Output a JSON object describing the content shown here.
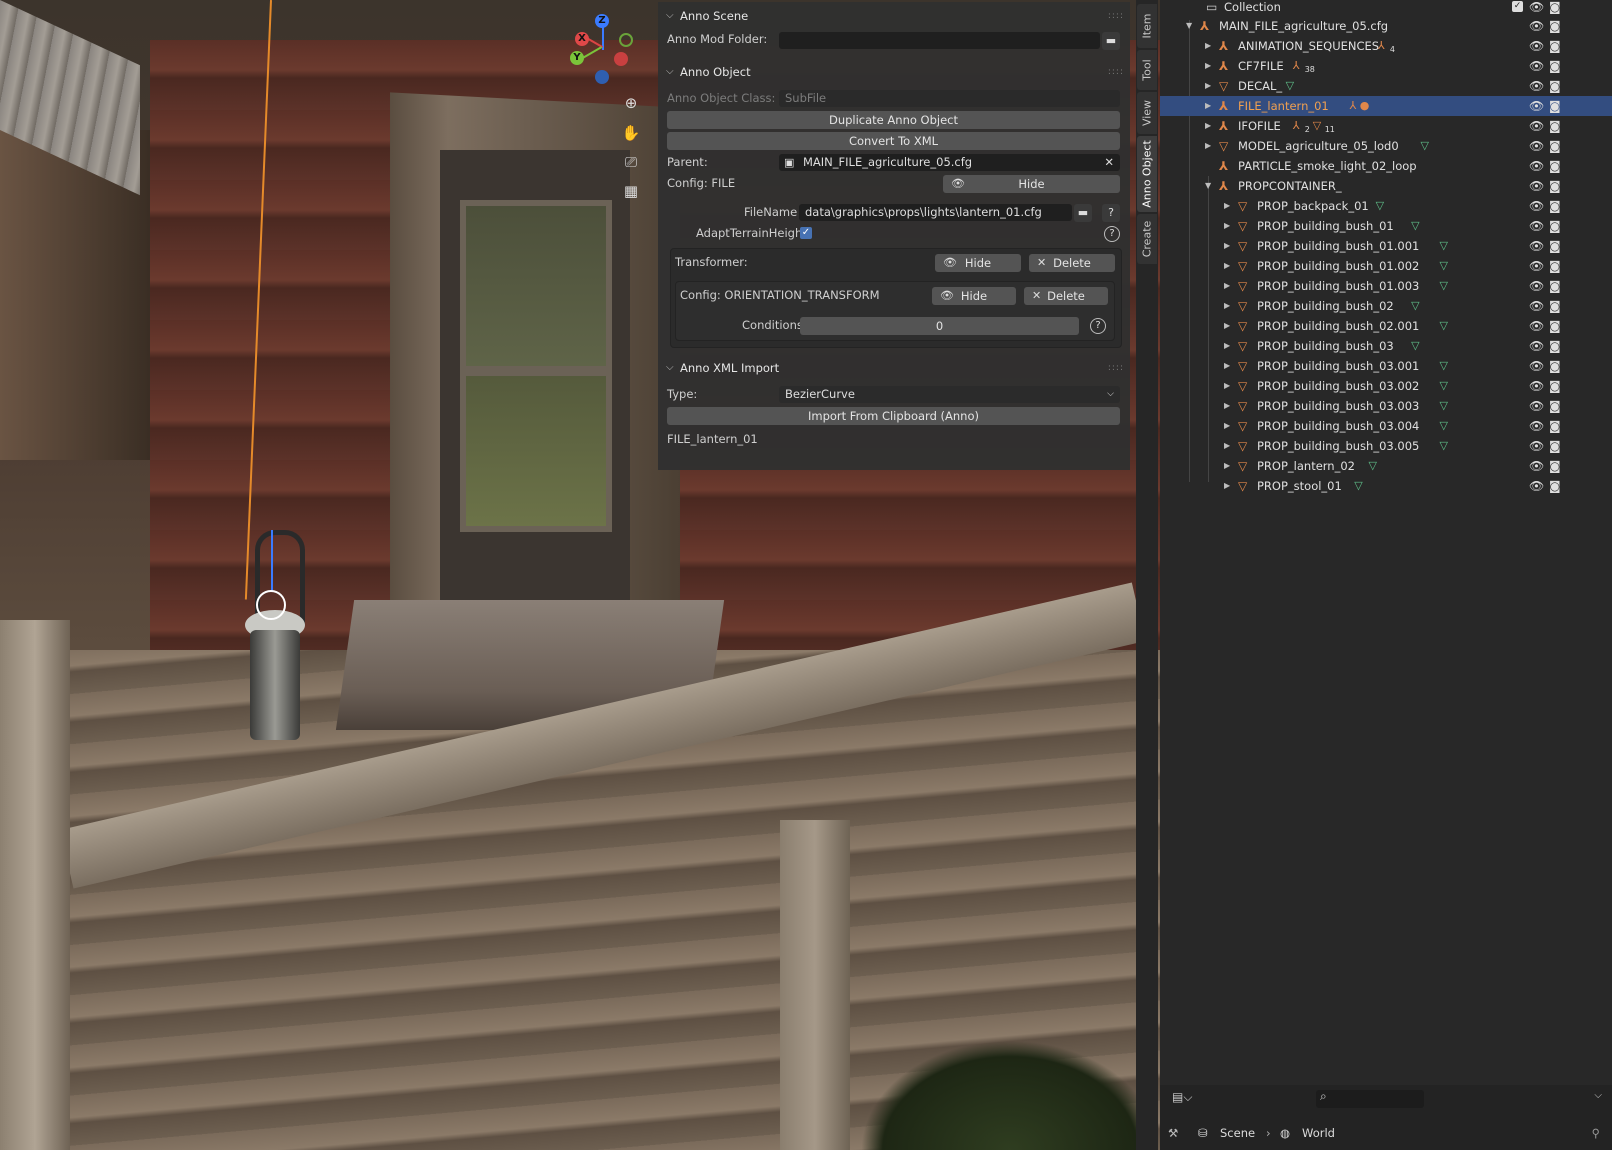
{
  "npanel": {
    "anno_scene": {
      "title": "Anno Scene",
      "mod_folder_label": "Anno Mod Folder:",
      "mod_folder_value": ""
    },
    "anno_object": {
      "title": "Anno Object",
      "class_label": "Anno Object Class:",
      "class_value": "SubFile",
      "duplicate_label": "Duplicate Anno Object",
      "convert_label": "Convert To XML",
      "parent_label": "Parent:",
      "parent_value": "MAIN_FILE_agriculture_05.cfg",
      "config_label": "Config: FILE",
      "hide_label": "Hide",
      "filename_label": "FileName",
      "filename_value": "data\\graphics\\props\\lights\\lantern_01.cfg",
      "adapt_label": "AdaptTerrainHeight",
      "adapt_checked": true,
      "transformer_label": "Transformer:",
      "delete_label": "Delete",
      "orient_label": "Config: ORIENTATION_TRANSFORM",
      "conditions_label": "Conditions",
      "conditions_value": "0"
    },
    "anno_xml_import": {
      "title": "Anno XML Import",
      "type_label": "Type:",
      "type_value": "BezierCurve",
      "import_label": "Import From Clipboard (Anno)",
      "current_name": "FILE_lantern_01"
    }
  },
  "side_tabs": [
    "Item",
    "Tool",
    "View",
    "Anno Object",
    "Create"
  ],
  "active_tab": "Anno Object",
  "gizmo": {
    "x": "X",
    "y": "Y",
    "z": "Z"
  },
  "outliner": {
    "collection": "Collection",
    "rows": [
      {
        "label": "MAIN_FILE_agriculture_05.cfg",
        "icon": "empty-icon",
        "expanded": true
      },
      {
        "label": "ANIMATION_SEQUENCES",
        "icon": "empty-icon",
        "badge": "4"
      },
      {
        "label": "CF7FILE",
        "icon": "empty-icon",
        "badge": "38"
      },
      {
        "label": "DECAL_",
        "icon": "mesh-icon"
      },
      {
        "label": "FILE_lantern_01",
        "icon": "empty-icon",
        "selected": true
      },
      {
        "label": "IFOFILE",
        "icon": "empty-icon",
        "badge": "2",
        "badge2": "11"
      },
      {
        "label": "MODEL_agriculture_05_lod0",
        "icon": "mesh-icon"
      },
      {
        "label": "PARTICLE_smoke_light_02_loop",
        "icon": "empty-icon"
      },
      {
        "label": "PROPCONTAINER_",
        "icon": "empty-icon",
        "expanded": true
      },
      {
        "label": "PROP_backpack_01",
        "icon": "mesh-icon"
      },
      {
        "label": "PROP_building_bush_01",
        "icon": "mesh-icon"
      },
      {
        "label": "PROP_building_bush_01.001",
        "icon": "mesh-icon"
      },
      {
        "label": "PROP_building_bush_01.002",
        "icon": "mesh-icon"
      },
      {
        "label": "PROP_building_bush_01.003",
        "icon": "mesh-icon"
      },
      {
        "label": "PROP_building_bush_02",
        "icon": "mesh-icon"
      },
      {
        "label": "PROP_building_bush_02.001",
        "icon": "mesh-icon"
      },
      {
        "label": "PROP_building_bush_03",
        "icon": "mesh-icon"
      },
      {
        "label": "PROP_building_bush_03.001",
        "icon": "mesh-icon"
      },
      {
        "label": "PROP_building_bush_03.002",
        "icon": "mesh-icon"
      },
      {
        "label": "PROP_building_bush_03.003",
        "icon": "mesh-icon"
      },
      {
        "label": "PROP_building_bush_03.004",
        "icon": "mesh-icon"
      },
      {
        "label": "PROP_building_bush_03.005",
        "icon": "mesh-icon"
      },
      {
        "label": "PROP_lantern_02",
        "icon": "mesh-icon"
      },
      {
        "label": "PROP_stool_01",
        "icon": "mesh-icon"
      }
    ]
  },
  "footer": {
    "scene": "Scene",
    "world": "World"
  },
  "colors": {
    "selection": "#334d80",
    "empty_icon": "#e0874a",
    "mesh_icon": "#e0874a",
    "data_icon": "#5fc08a",
    "accent_blue": "#4772b3"
  }
}
